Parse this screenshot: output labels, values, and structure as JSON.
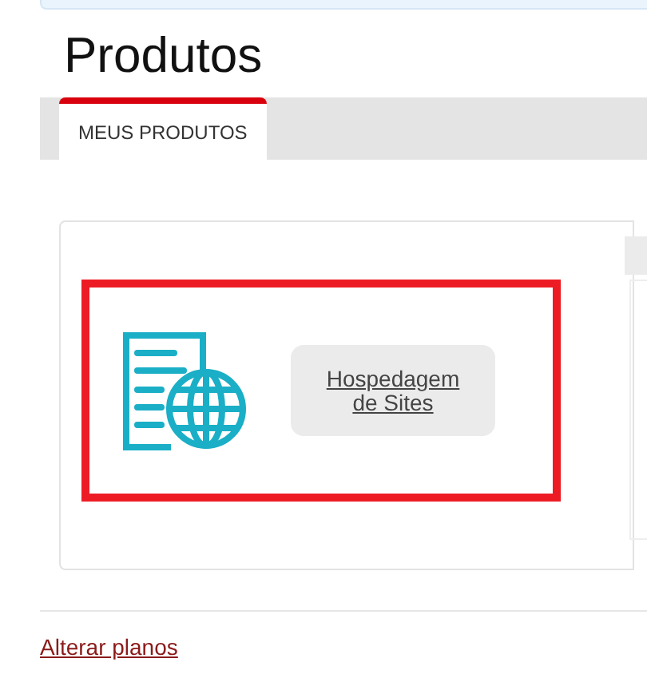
{
  "page_title": "Produtos",
  "tabs": [
    {
      "label": "MEUS PRODUTOS",
      "selected": true
    }
  ],
  "products": [
    {
      "name": "Hospedagem de Sites",
      "highlighted": true
    }
  ],
  "footer_link": "Alterar planos"
}
